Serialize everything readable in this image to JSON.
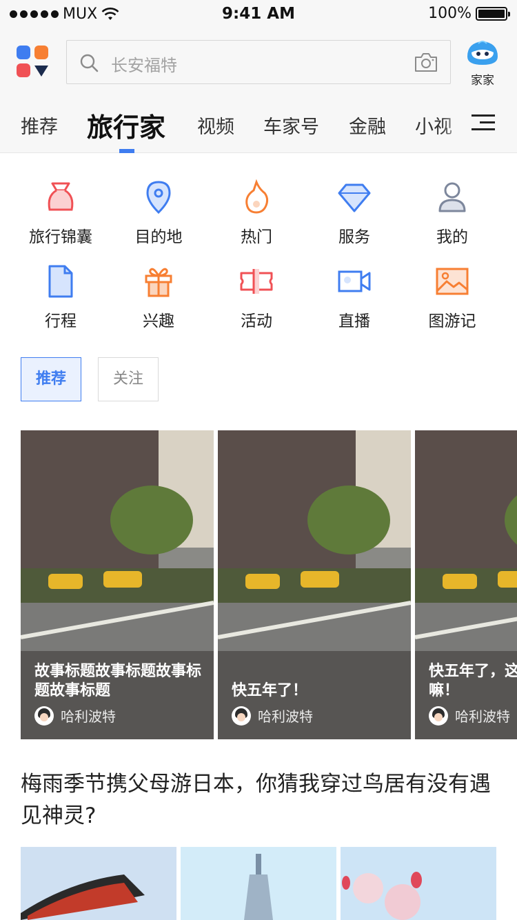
{
  "status_bar": {
    "carrier": "MUX",
    "time": "9:41 AM",
    "battery": "100%"
  },
  "header": {
    "search_placeholder": "长安福特",
    "mascot_label": "家家"
  },
  "tabs": [
    {
      "label": "推荐"
    },
    {
      "label": "旅行家"
    },
    {
      "label": "视频"
    },
    {
      "label": "车家号"
    },
    {
      "label": "金融"
    },
    {
      "label": "小视"
    }
  ],
  "active_tab": "旅行家",
  "grid": [
    {
      "label": "旅行锦囊",
      "icon": "travel-bag-icon"
    },
    {
      "label": "目的地",
      "icon": "location-pin-icon"
    },
    {
      "label": "热门",
      "icon": "flame-icon"
    },
    {
      "label": "服务",
      "icon": "diamond-icon"
    },
    {
      "label": "我的",
      "icon": "user-icon"
    },
    {
      "label": "行程",
      "icon": "document-icon"
    },
    {
      "label": "兴趣",
      "icon": "gift-icon"
    },
    {
      "label": "活动",
      "icon": "ticket-icon"
    },
    {
      "label": "直播",
      "icon": "video-camera-icon"
    },
    {
      "label": "图游记",
      "icon": "picture-icon"
    }
  ],
  "filters": {
    "active": "推荐",
    "inactive": "关注"
  },
  "stories": [
    {
      "title": "故事标题故事标题故事标题故事标题",
      "author": "哈利波特"
    },
    {
      "title": "快五年了！",
      "author": "哈利波特"
    },
    {
      "title": "快五年了，这车很给力嘛！",
      "author": "哈利波特"
    }
  ],
  "article": {
    "title": "梅雨季节携父母游日本，你猜我穿过鸟居有没有遇见神灵?"
  },
  "colors": {
    "accent": "#3f7df0",
    "red": "#f05155",
    "orange": "#f77f33",
    "navy": "#1b2b4d"
  }
}
